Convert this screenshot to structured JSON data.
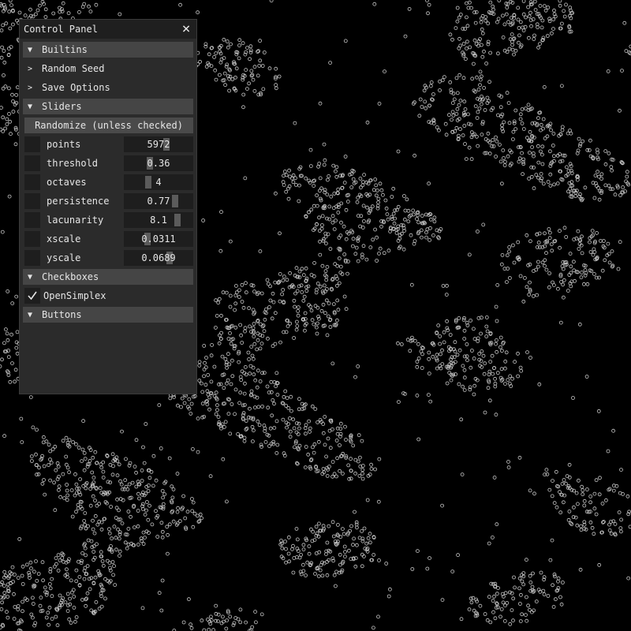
{
  "panel": {
    "title": "Control Panel",
    "close_icon": "close-icon"
  },
  "sections": {
    "builtins": "Builtins",
    "random_seed": "Random Seed",
    "save_options": "Save Options",
    "sliders": "Sliders",
    "checkboxes": "Checkboxes",
    "buttons": "Buttons"
  },
  "randomize_label": "Randomize (unless checked)",
  "sliders": [
    {
      "label": "points",
      "value": "5972",
      "fraction": 0.63
    },
    {
      "label": "threshold",
      "value": "0.36",
      "fraction": 0.36
    },
    {
      "label": "octaves",
      "value": "4",
      "fraction": 0.33
    },
    {
      "label": "persistence",
      "value": "0.77",
      "fraction": 0.77
    },
    {
      "label": "lacunarity",
      "value": "8.1",
      "fraction": 0.81
    },
    {
      "label": "xscale",
      "value": "0.0311",
      "fraction": 0.31
    },
    {
      "label": "yscale",
      "value": "0.0689",
      "fraction": 0.69
    }
  ],
  "checkbox": {
    "label": "OpenSimplex",
    "checked": true
  },
  "colors": {
    "background": "#000000",
    "points": "#c8c8c8"
  }
}
